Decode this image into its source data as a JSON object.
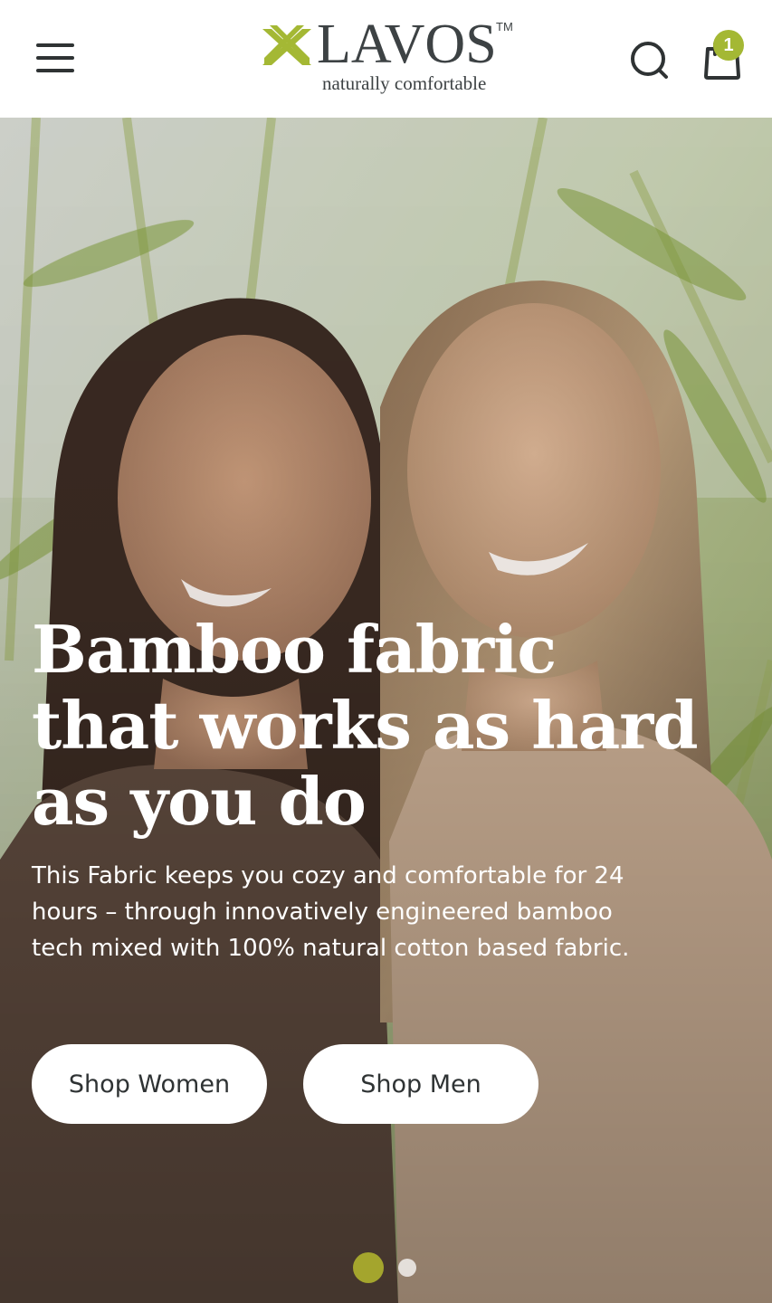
{
  "brand": {
    "name": "LAVOS",
    "trademark": "TM",
    "tagline": "naturally comfortable"
  },
  "header": {
    "menu_icon": "hamburger-menu-icon",
    "search_icon": "search-icon",
    "cart_icon": "shopping-bag-icon",
    "cart_count": "1"
  },
  "hero": {
    "title_lines": [
      "Bamboo fabric",
      "that works as hard",
      "as you do"
    ],
    "description": "This Fabric keeps you cozy and comfortable for 24 hours – through innovatively engineered bamboo tech mixed with 100% natural cotton based fabric.",
    "buttons": {
      "women": "Shop Women",
      "men": "Shop Men"
    },
    "slides": {
      "count": 2,
      "active_index": 0
    },
    "image_description_icon": "hero-photo"
  },
  "colors": {
    "accent": "#a4b834",
    "dot_active": "#a4a52d",
    "text_dark": "#2f3334",
    "logo_text": "#3d4244"
  }
}
